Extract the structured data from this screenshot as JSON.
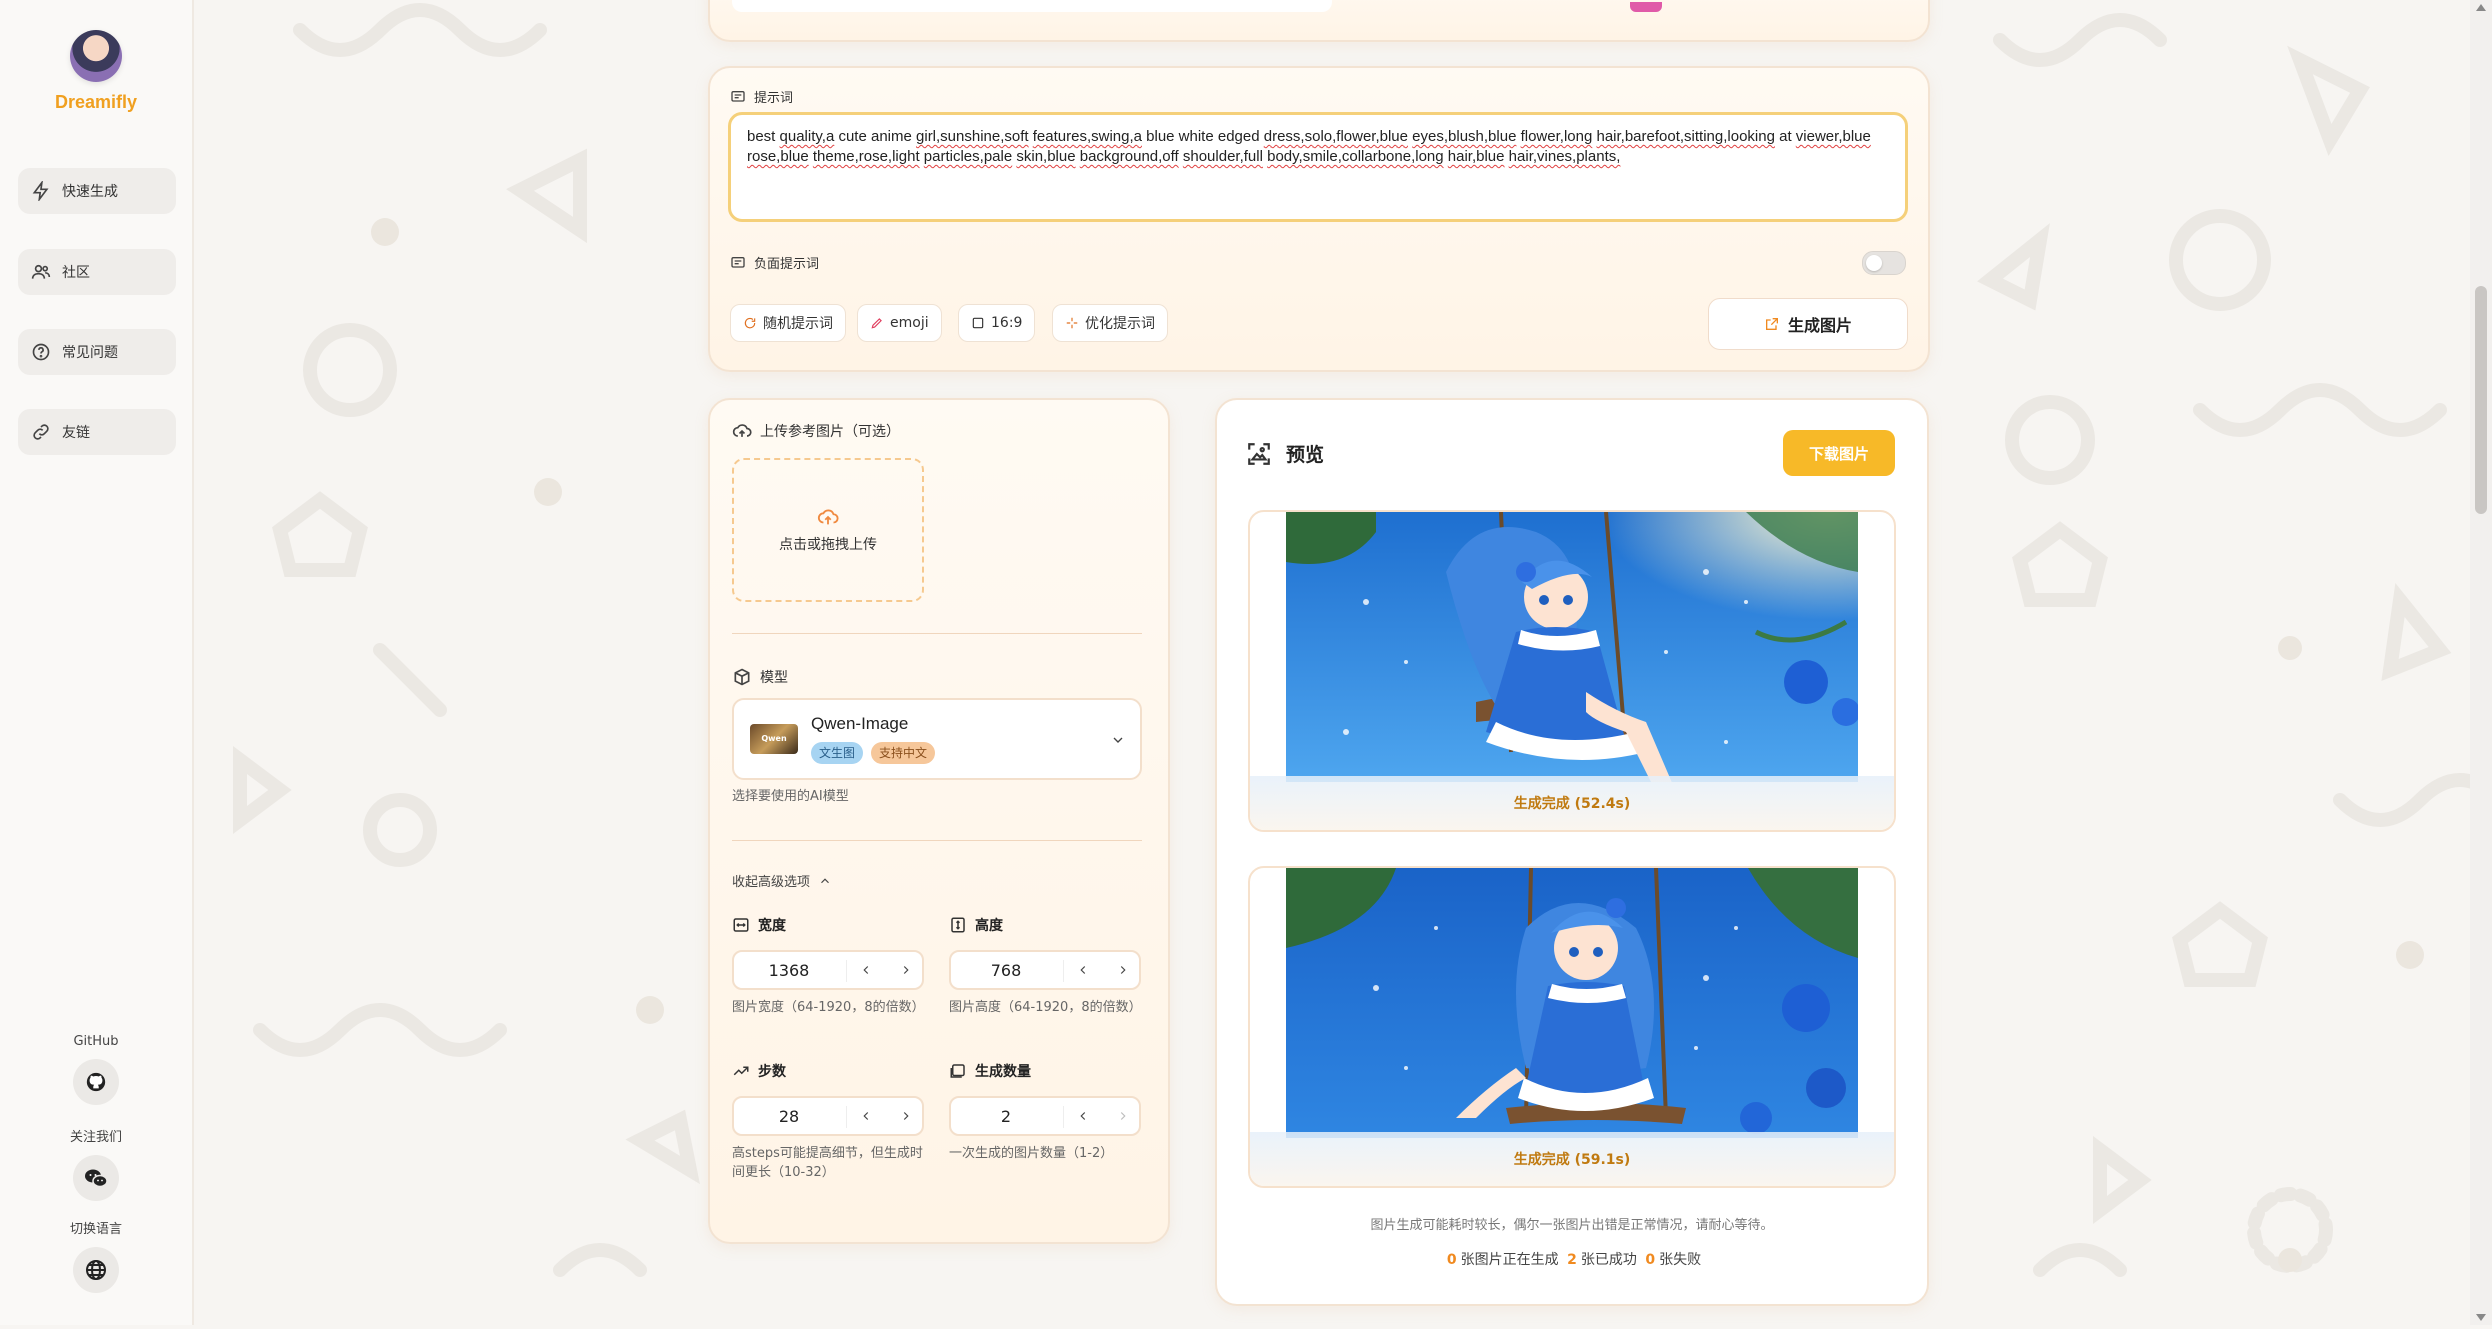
{
  "app": {
    "name": "Dreamifly"
  },
  "sidebar": {
    "items": [
      {
        "label": "快速生成",
        "icon": "lightning-icon"
      },
      {
        "label": "社区",
        "icon": "users-icon"
      },
      {
        "label": "常见问题",
        "icon": "help-circle-icon"
      },
      {
        "label": "友链",
        "icon": "link-icon"
      }
    ],
    "footer": {
      "github_label": "GitHub",
      "follow_label": "关注我们",
      "language_label": "切换语言"
    }
  },
  "prompt": {
    "label": "提示词",
    "text_plain": [
      "best ",
      "quality,a",
      " cute anime ",
      "girl,sunshine,soft",
      " ",
      "features,swing,a",
      " blue white edged ",
      "dress,solo,flower,blue",
      " ",
      "eyes,blush,blue",
      " ",
      "flower,long",
      " ",
      "hair,barefoot,sitting,looking",
      " at ",
      "viewer,blue"
    ],
    "line2": [
      "rose,blue",
      " ",
      "theme,rose,light",
      " ",
      "particles,pale",
      " ",
      "skin,blue",
      " ",
      "background,off",
      " ",
      "shoulder,full",
      " ",
      "body,smile,collarbone,long",
      " ",
      "hair,blue",
      " ",
      "hair,vines,plants,"
    ],
    "negative_label": "负面提示词",
    "negative_enabled": false,
    "buttons": {
      "random": "随机提示词",
      "emoji": "emoji",
      "ratio": "16:9",
      "optimize": "优化提示词"
    },
    "generate_label": "生成图片"
  },
  "settings": {
    "upload_label": "上传参考图片（可选）",
    "upload_hint": "点击或拖拽上传",
    "model_label": "模型",
    "model": {
      "name": "Qwen-Image",
      "thumb_text": "Qwen Image",
      "tags": [
        "文生图",
        "支持中文"
      ]
    },
    "model_hint": "选择要使用的AI模型",
    "advanced_toggle": "收起高级选项",
    "width": {
      "label": "宽度",
      "value": "1368",
      "hint": "图片宽度（64-1920，8的倍数）"
    },
    "height": {
      "label": "高度",
      "value": "768",
      "hint": "图片高度（64-1920，8的倍数）"
    },
    "steps": {
      "label": "步数",
      "value": "28",
      "hint": "高steps可能提高细节，但生成时间更长（10-32）"
    },
    "count": {
      "label": "生成数量",
      "value": "2",
      "hint": "一次生成的图片数量（1-2）"
    }
  },
  "preview": {
    "title": "预览",
    "download_label": "下载图片",
    "images": [
      {
        "caption": "生成完成 (52.4s)"
      },
      {
        "caption": "生成完成 (59.1s)"
      }
    ],
    "notice": "图片生成可能耗时较长，偶尔一张图片出错是正常情况，请耐心等待。",
    "stats": {
      "generating": "0",
      "generating_label": "张图片正在生成",
      "success": "2",
      "success_label": "张已成功",
      "failed": "0",
      "failed_label": "张失败"
    }
  },
  "colors": {
    "accent": "#f7b928",
    "brand": "#f0a020",
    "border": "#f3e3d2"
  }
}
